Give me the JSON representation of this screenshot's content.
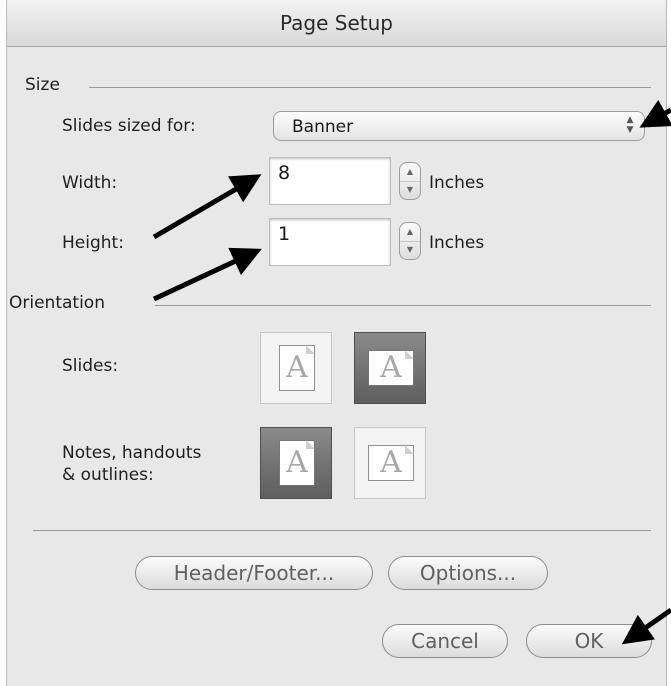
{
  "dialog": {
    "title": "Page Setup"
  },
  "size": {
    "section_label": "Size",
    "slides_sized_for_label": "Slides sized for:",
    "slides_sized_for_value": "Banner",
    "width_label": "Width:",
    "width_value": "8",
    "width_unit": "Inches",
    "height_label": "Height:",
    "height_value": "1",
    "height_unit": "Inches"
  },
  "orientation": {
    "section_label": "Orientation",
    "slides_label": "Slides:",
    "notes_label_line1": "Notes, handouts",
    "notes_label_line2": "& outlines:",
    "slides_selected": "landscape",
    "notes_selected": "portrait",
    "icon_glyph": "A"
  },
  "buttons": {
    "header_footer": "Header/Footer...",
    "options": "Options...",
    "cancel": "Cancel",
    "ok": "OK"
  }
}
